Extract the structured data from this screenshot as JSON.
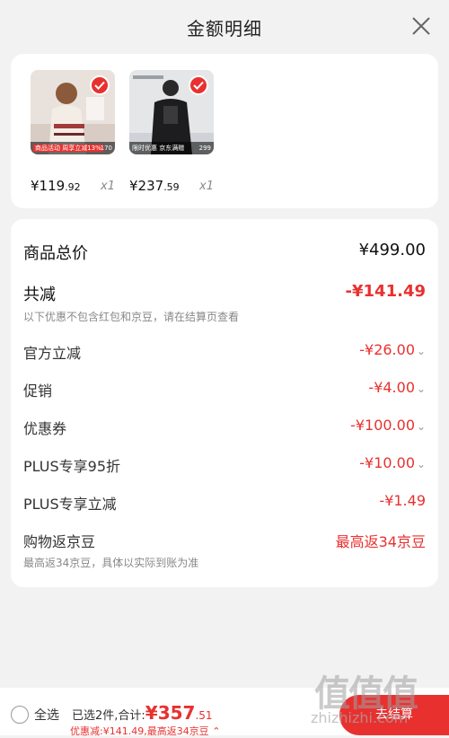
{
  "header": {
    "title": "金额明细"
  },
  "products": [
    {
      "price_int": "¥119",
      "price_dec": ".92",
      "qty": "x1",
      "promo": "商品活动 周享立减13%",
      "count": "170"
    },
    {
      "price_int": "¥237",
      "price_dec": ".59",
      "qty": "x1",
      "promo": "限时优惠 京东满赠",
      "count": "299"
    }
  ],
  "detail": {
    "total_label": "商品总价",
    "total_value": "¥499.00",
    "discount_label": "共减",
    "discount_value": "-¥141.49",
    "discount_note": "以下优惠不包含红包和京豆，请在结算页查看",
    "items": [
      {
        "label": "官方立减",
        "value": "-¥26.00"
      },
      {
        "label": "促销",
        "value": "-¥4.00"
      },
      {
        "label": "优惠券",
        "value": "-¥100.00"
      },
      {
        "label": "PLUS专享95折",
        "value": "-¥10.00"
      },
      {
        "label": "PLUS专享立减",
        "value": "-¥1.49"
      }
    ],
    "beans_label": "购物返京豆",
    "beans_value": "最高返34京豆",
    "beans_note": "最高返34京豆，具体以实际到账为准"
  },
  "bottom": {
    "select_all": "全选",
    "summary_prefix": "已选2件,合计:",
    "total": "¥357",
    "cents": ".51",
    "savings": "优惠减:¥141.49,最高返34京豆",
    "checkout": "去结算"
  },
  "watermark": {
    "big": "值值值",
    "small": "zhizhizhi.com"
  },
  "colors": {
    "accent": "#e8312f",
    "background": "#f2f2f2"
  }
}
